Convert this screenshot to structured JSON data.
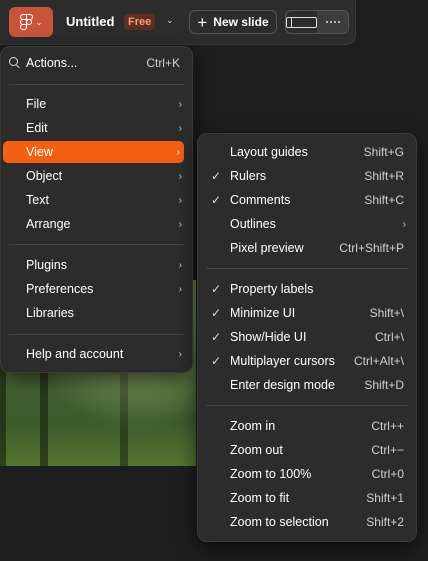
{
  "toolbar": {
    "title": "Untitled",
    "badge": "Free",
    "new_slide_label": "New slide"
  },
  "main_menu": {
    "actions": {
      "label": "Actions...",
      "shortcut": "Ctrl+K"
    },
    "groups": [
      [
        {
          "label": "File",
          "submenu": true
        },
        {
          "label": "Edit",
          "submenu": true
        },
        {
          "label": "View",
          "submenu": true,
          "highlighted": true
        },
        {
          "label": "Object",
          "submenu": true
        },
        {
          "label": "Text",
          "submenu": true
        },
        {
          "label": "Arrange",
          "submenu": true
        }
      ],
      [
        {
          "label": "Plugins",
          "submenu": true
        },
        {
          "label": "Preferences",
          "submenu": true
        },
        {
          "label": "Libraries",
          "submenu": false
        }
      ],
      [
        {
          "label": "Help and account",
          "submenu": true
        }
      ]
    ]
  },
  "view_menu": {
    "groups": [
      [
        {
          "label": "Layout guides",
          "shortcut": "Shift+G",
          "checked": false
        },
        {
          "label": "Rulers",
          "shortcut": "Shift+R",
          "checked": true
        },
        {
          "label": "Comments",
          "shortcut": "Shift+C",
          "checked": true
        },
        {
          "label": "Outlines",
          "shortcut": "",
          "checked": false,
          "submenu": true
        },
        {
          "label": "Pixel preview",
          "shortcut": "Ctrl+Shift+P",
          "checked": false
        }
      ],
      [
        {
          "label": "Property labels",
          "shortcut": "",
          "checked": true
        },
        {
          "label": "Minimize UI",
          "shortcut": "Shift+\\",
          "checked": true
        },
        {
          "label": "Show/Hide UI",
          "shortcut": "Ctrl+\\",
          "checked": true
        },
        {
          "label": "Multiplayer cursors",
          "shortcut": "Ctrl+Alt+\\",
          "checked": true
        },
        {
          "label": "Enter design mode",
          "shortcut": "Shift+D",
          "checked": false
        }
      ],
      [
        {
          "label": "Zoom in",
          "shortcut": "Ctrl++",
          "checked": false
        },
        {
          "label": "Zoom out",
          "shortcut": "Ctrl+−",
          "checked": false
        },
        {
          "label": "Zoom to 100%",
          "shortcut": "Ctrl+0",
          "checked": false
        },
        {
          "label": "Zoom to fit",
          "shortcut": "Shift+1",
          "checked": false
        },
        {
          "label": "Zoom to selection",
          "shortcut": "Shift+2",
          "checked": false
        }
      ]
    ]
  },
  "colors": {
    "accent": "#f35f13",
    "app_button": "#c8553a",
    "menu_bg": "#2c2c2c"
  }
}
